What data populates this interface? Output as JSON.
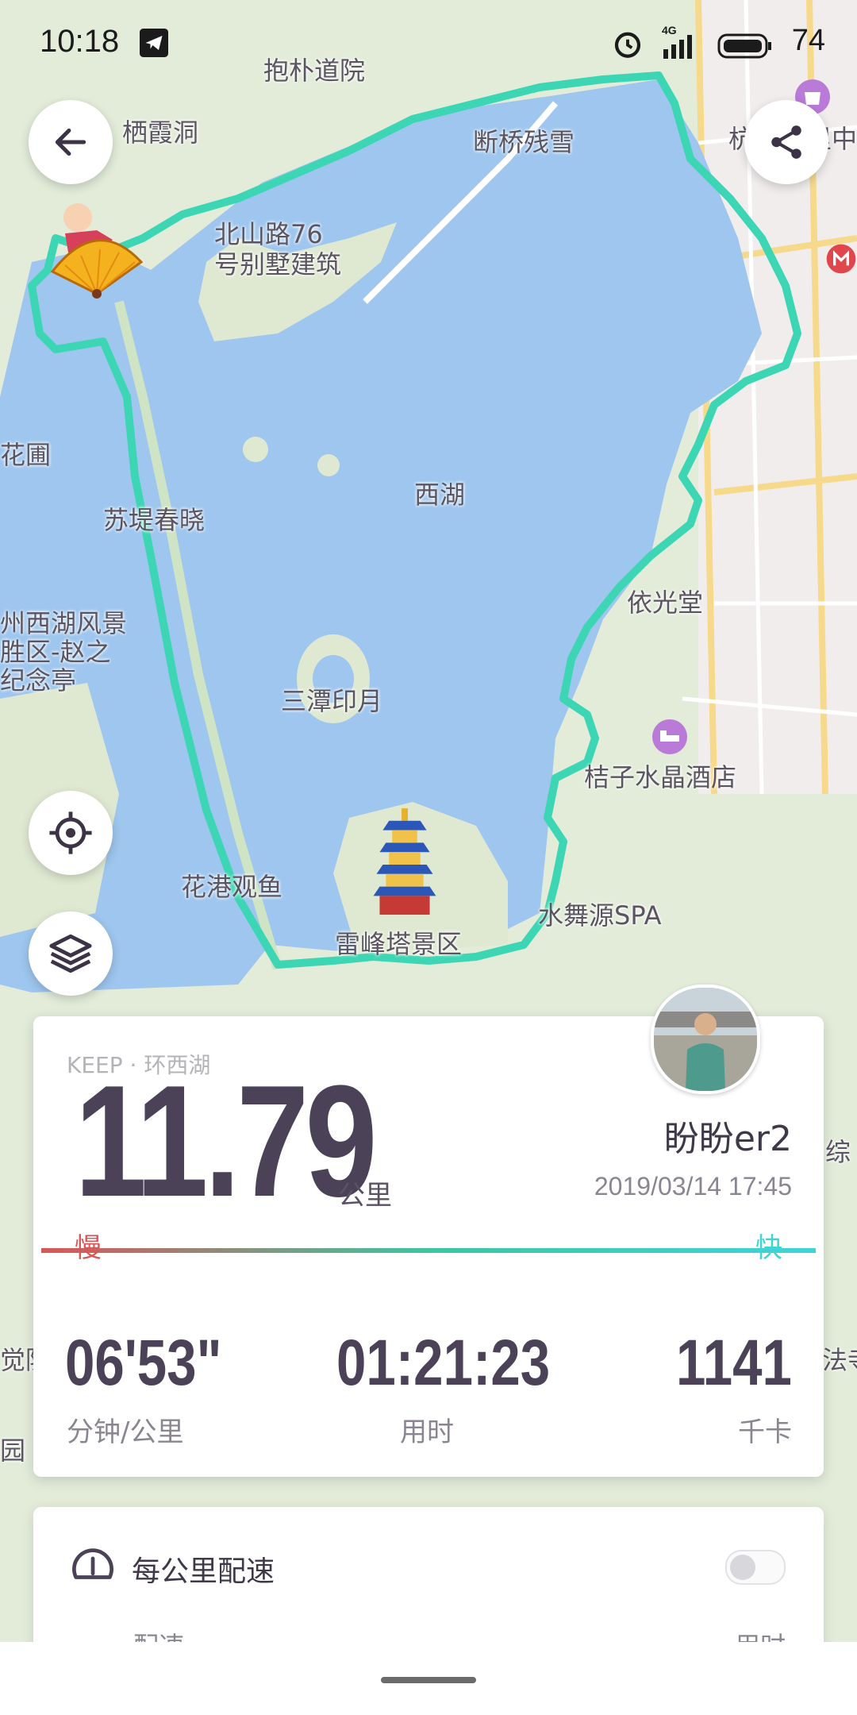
{
  "status_bar": {
    "time": "10:18",
    "network": "4G",
    "battery": "74"
  },
  "map": {
    "labels": {
      "baopu": "抱朴道院",
      "qixia": "栖霞洞",
      "duanqiao": "断桥残雪",
      "beishan1": "北山路76",
      "beishan2": "号别墅建筑",
      "xihu": "西湖",
      "sudi": "苏堤春晓",
      "huapu": "花圃",
      "zhao1": "州西湖风景",
      "zhao2": "胜区-赵之",
      "zhao3": "纪念亭",
      "santan": "三潭印月",
      "yiguang": "依光堂",
      "hotel": "桔子水晶酒店",
      "huagang": "花港观鱼",
      "spa": "水舞源SPA",
      "leifeng": "雷峰塔景区",
      "edge1": "杭",
      "edge2": "里中",
      "edge3": "综",
      "edge4": "觉陇",
      "edge5": "法寺",
      "edge6": "园"
    }
  },
  "summary": {
    "tag": "KEEP · 环西湖",
    "distance": "11.79",
    "distance_unit": "公里",
    "user_name": "盼盼er2",
    "datetime": "2019/03/14 17:45",
    "slow_label": "慢",
    "fast_label": "快",
    "pace": "06'53\"",
    "pace_label": "分钟/公里",
    "duration": "01:21:23",
    "duration_label": "用时",
    "calories": "1141",
    "calories_label": "千卡"
  },
  "pace_section": {
    "title": "每公里配速",
    "col_left": "配速",
    "col_right": "用时"
  },
  "colors": {
    "route": "#3cd6b4",
    "lake": "#9ec6ee",
    "accent_slow": "#d95757",
    "accent_fast": "#3fd4d8"
  }
}
